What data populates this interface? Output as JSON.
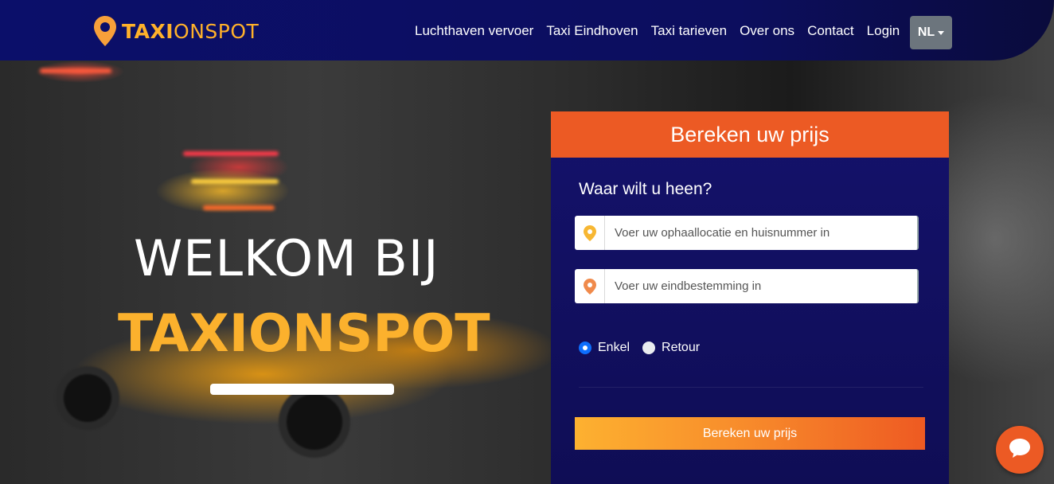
{
  "header": {
    "brand_bold": "TAXI",
    "brand_light": "ONSPOT",
    "nav": [
      {
        "label": "Luchthaven vervoer"
      },
      {
        "label": "Taxi Eindhoven"
      },
      {
        "label": "Taxi tarieven"
      },
      {
        "label": "Over ons"
      },
      {
        "label": "Contact"
      },
      {
        "label": "Login"
      }
    ],
    "language": "NL"
  },
  "hero": {
    "welcome": "WELKOM BIJ",
    "brand": "TAXIONSPOT"
  },
  "booking": {
    "title": "Bereken uw prijs",
    "subtitle": "Waar wilt u heen?",
    "pickup_placeholder": "Voer uw ophaallocatie en huisnummer in",
    "destination_placeholder": "Voer uw eindbestemming in",
    "trip_options": [
      {
        "label": "Enkel",
        "selected": true
      },
      {
        "label": "Retour",
        "selected": false
      }
    ],
    "submit_label": "Bereken uw prijs"
  },
  "colors": {
    "navy": "#0b0f6a",
    "accent_orange": "#ec5a24",
    "accent_yellow": "#fbb12d",
    "pin_yellow": "#f7b733",
    "pin_orange": "#f08a4b"
  },
  "icons": {
    "logo": "location-pin-icon",
    "pickup": "map-pin-icon",
    "destination": "map-pin-icon",
    "chat": "chat-bubble-icon",
    "language": "chevron-down-icon"
  }
}
